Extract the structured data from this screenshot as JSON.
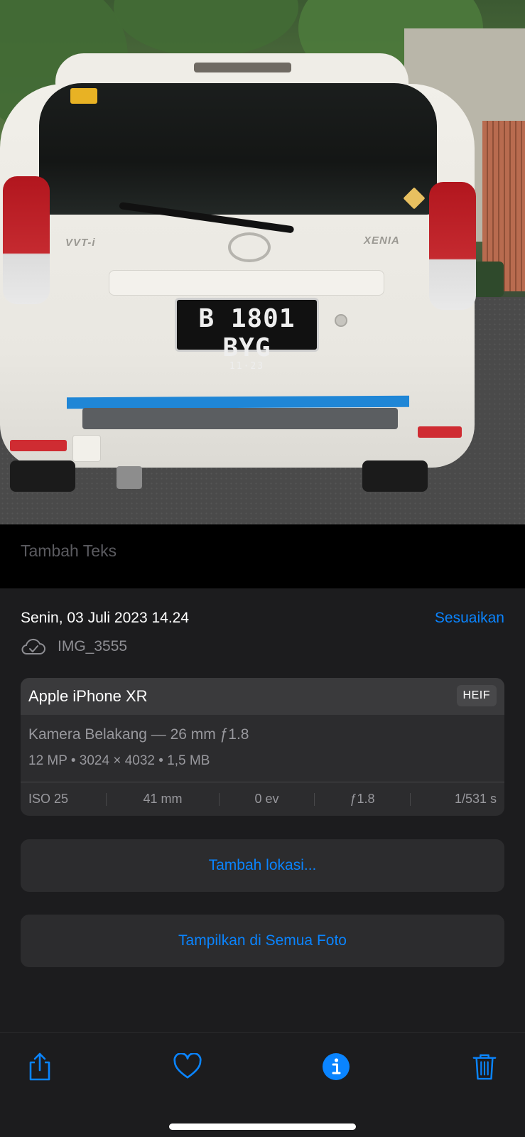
{
  "photo": {
    "plate_number": "B 1801 BYG",
    "plate_expiry": "11·23",
    "badge_left": "VVT-i",
    "badge_right": "XENIA"
  },
  "caption": {
    "placeholder": "Tambah Teks"
  },
  "info": {
    "date": "Senin, 03 Juli 2023 14.24",
    "adjust_label": "Sesuaikan",
    "cloud_icon": "cloud-check-icon",
    "filename": "IMG_3555"
  },
  "exif": {
    "device": "Apple iPhone XR",
    "format": "HEIF",
    "lens": "Kamera Belakang — 26 mm ƒ1.8",
    "specs": "12 MP  •  3024 × 4032  •  1,5 MB",
    "iso": "ISO 25",
    "focal": "41 mm",
    "ev": "0 ev",
    "aperture": "ƒ1.8",
    "shutter": "1/531 s"
  },
  "actions": {
    "add_location": "Tambah lokasi...",
    "show_all": "Tampilkan di Semua Foto"
  },
  "toolbar": {
    "share_icon": "share-icon",
    "favorite_icon": "heart-icon",
    "info_icon": "info-icon",
    "delete_icon": "trash-icon"
  },
  "colors": {
    "accent": "#0a84ff",
    "panel_bg": "#1c1c1e",
    "card_bg": "#2c2c2e",
    "secondary_text": "#98989d"
  }
}
